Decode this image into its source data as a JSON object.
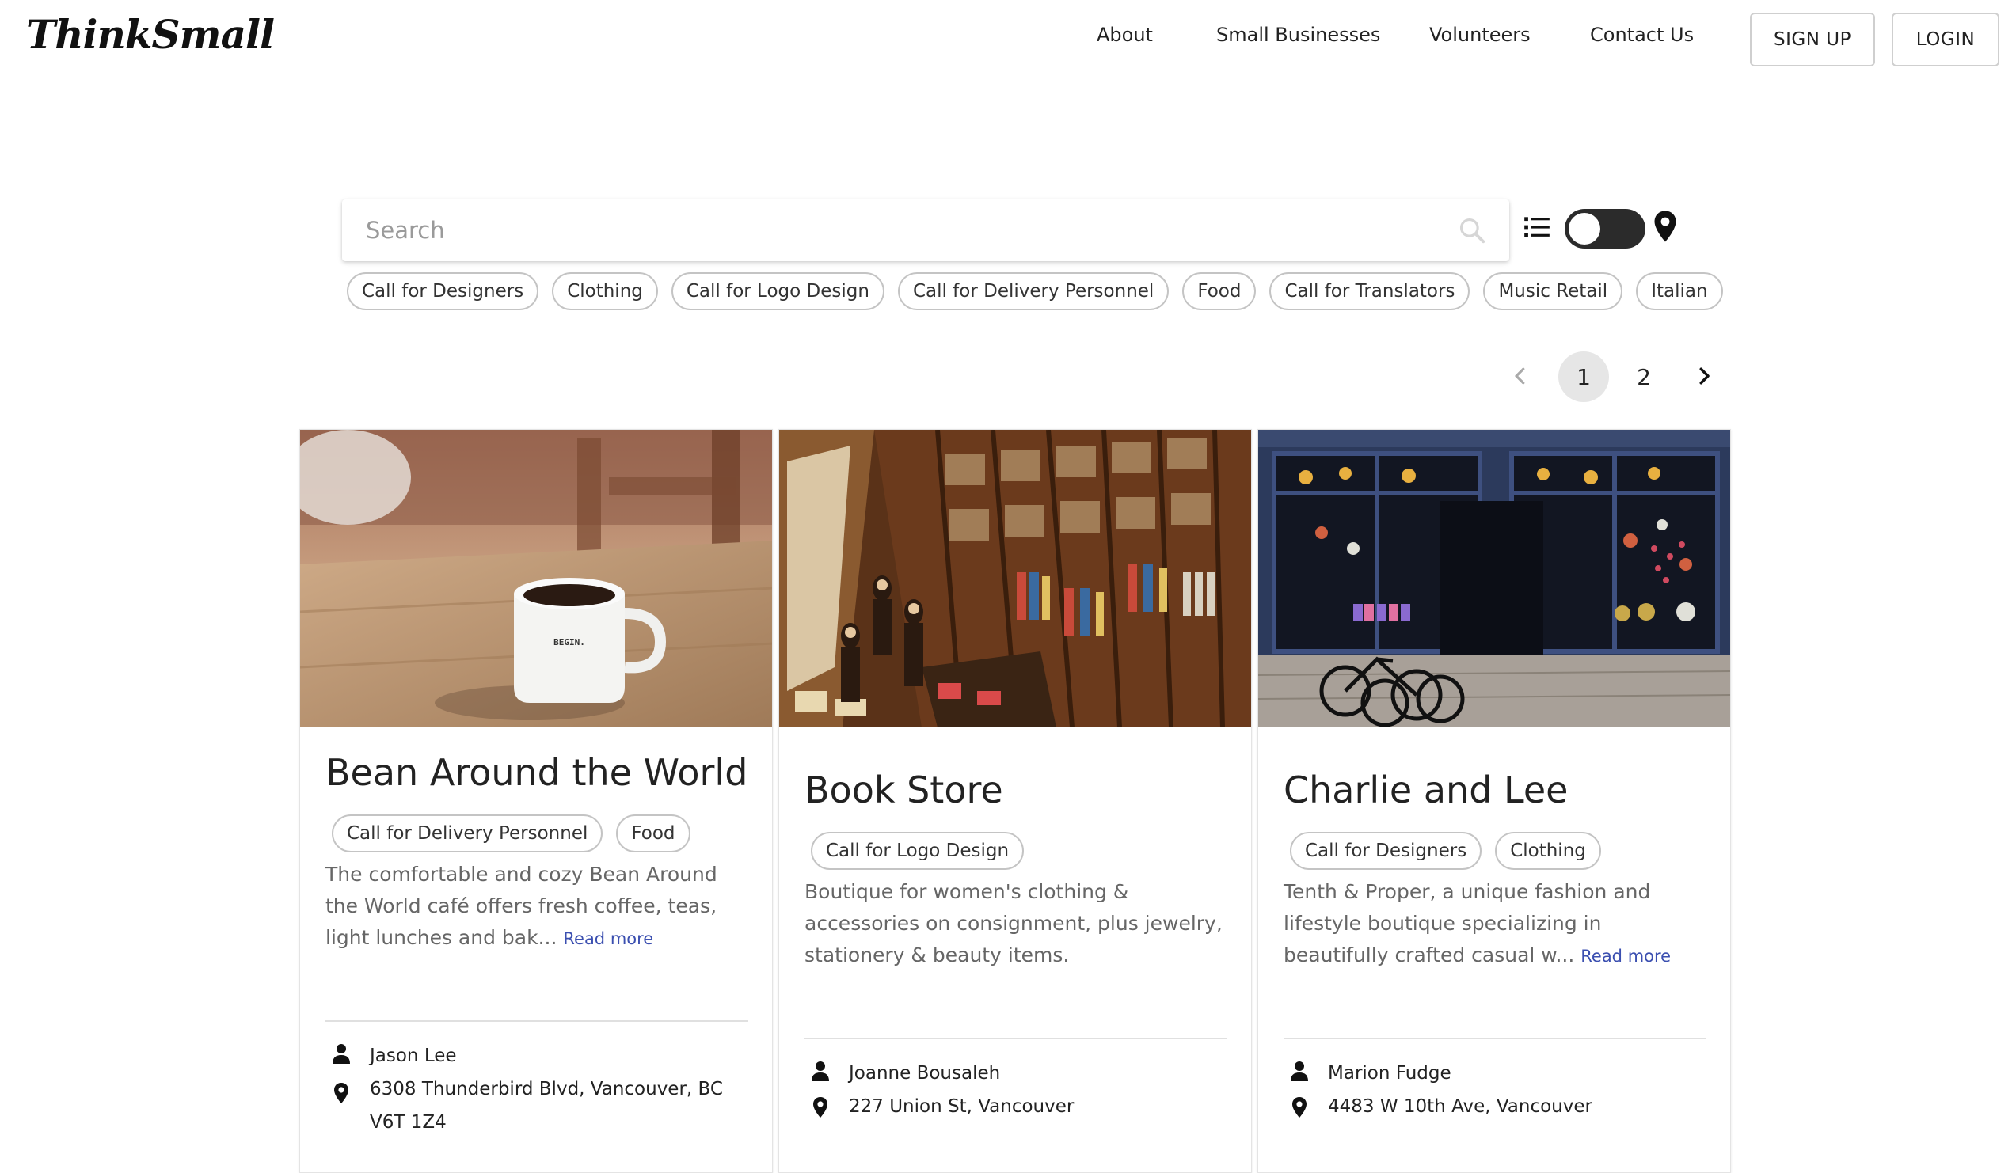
{
  "header": {
    "logo": "ThinkSmall",
    "nav": [
      "About",
      "Small Businesses",
      "Volunteers",
      "Contact Us"
    ],
    "signup_label": "SIGN UP",
    "login_label": "LOGIN"
  },
  "search": {
    "placeholder": "Search",
    "value": ""
  },
  "view_toggle": {
    "left_icon": "list-icon",
    "right_icon": "map-pin-icon",
    "mode": "list"
  },
  "filters": [
    "Call for Designers",
    "Clothing",
    "Call for Logo Design",
    "Call for Delivery Personnel",
    "Food",
    "Call for Translators",
    "Music Retail",
    "Italian"
  ],
  "pagination": {
    "pages": [
      "1",
      "2"
    ],
    "current": "1"
  },
  "cards": [
    {
      "title": "Bean Around the World",
      "tags": [
        "Call for Delivery Personnel",
        "Food"
      ],
      "description": "The comfortable and cozy Bean Around the World café offers fresh coffee, teas, light lunches and bak...",
      "read_more": "Read more",
      "owner": "Jason Lee",
      "address": "6308 Thunderbird Blvd, Vancouver, BC V6T 1Z4",
      "image_text": "BEGIN."
    },
    {
      "title": "Book Store",
      "tags": [
        "Call for Logo Design"
      ],
      "description": "Boutique for women's clothing & accessories on consignment, plus jewelry, stationery & beauty items.",
      "read_more": "",
      "owner": "Joanne Bousaleh",
      "address": "227 Union St, Vancouver"
    },
    {
      "title": "Charlie and Lee",
      "tags": [
        "Call for Designers",
        "Clothing"
      ],
      "description": "Tenth & Proper, a unique fashion and lifestyle boutique specializing in beautifully crafted casual w...",
      "read_more": "Read more",
      "owner": "Marion Fudge",
      "address": "4483 W 10th Ave, Vancouver"
    }
  ]
}
